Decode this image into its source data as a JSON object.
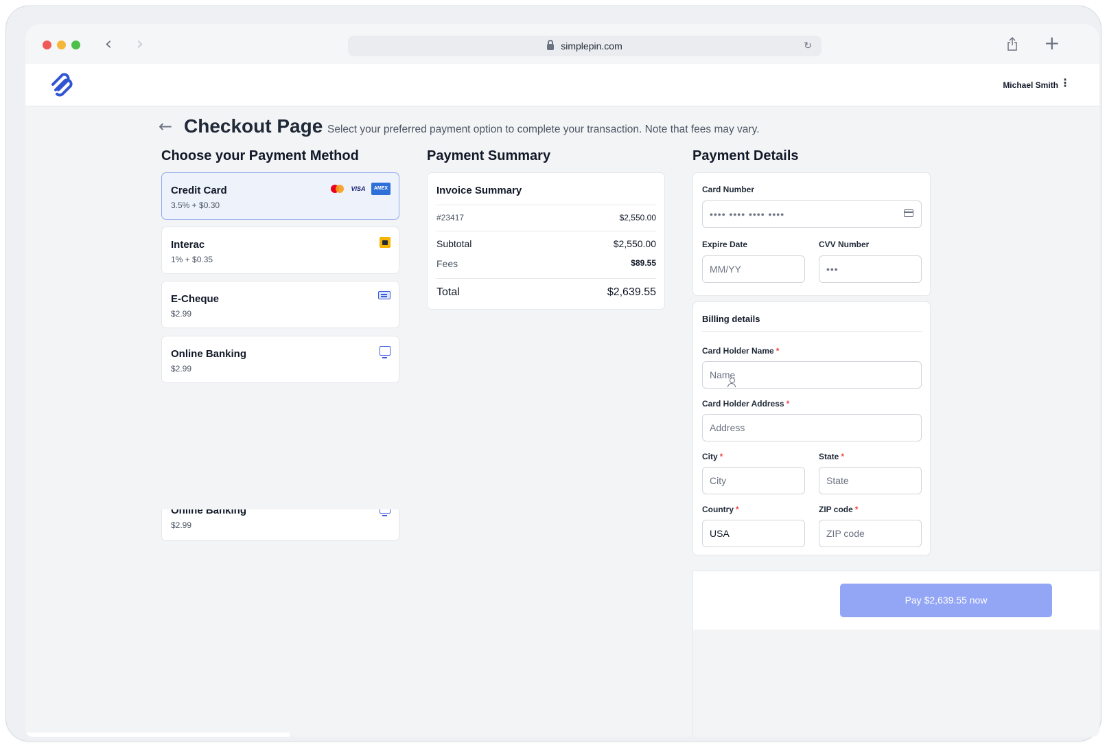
{
  "browser": {
    "url": "simplepin.com"
  },
  "header": {
    "user_name": "Michael Smith"
  },
  "page": {
    "title": "Checkout Page",
    "subtitle": "Select your preferred payment option to complete your transaction. Note that fees may vary."
  },
  "payment_methods": {
    "heading": "Choose your Payment Method",
    "items": [
      {
        "name": "Credit Card",
        "fee": "3.5% + $0.30",
        "selected": true,
        "icons": [
          "mastercard-icon",
          "visa-icon",
          "amex-icon"
        ]
      },
      {
        "name": "Interac",
        "fee": "1% + $0.35",
        "selected": false,
        "icons": [
          "interac-icon"
        ]
      },
      {
        "name": "E-Cheque",
        "fee": "$2.99",
        "selected": false,
        "icons": [
          "cheque-icon"
        ]
      },
      {
        "name": "Online Banking",
        "fee": "$2.99",
        "selected": false,
        "icons": [
          "online-banking-icon"
        ]
      }
    ],
    "ghost_item": {
      "name": "Online Banking",
      "fee": "$2.99"
    }
  },
  "summary": {
    "heading": "Payment Summary",
    "card_title": "Invoice Summary",
    "invoice_number": "#23417",
    "invoice_amount": "$2,550.00",
    "subtotal_label": "Subtotal",
    "subtotal_value": "$2,550.00",
    "fees_label": "Fees",
    "fees_value": "$89.55",
    "total_label": "Total",
    "total_value": "$2,639.55"
  },
  "details": {
    "heading": "Payment Details",
    "card_number_label": "Card Number",
    "card_number_value": "•••• •••• •••• ••••",
    "expire_label": "Expire Date",
    "expire_placeholder": "MM/YY",
    "cvv_label": "CVV Number",
    "cvv_value": "•••",
    "billing_title": "Billing details",
    "holder_name_label": "Card Holder Name",
    "holder_name_placeholder": "Name",
    "holder_address_label": "Card Holder Address",
    "holder_address_placeholder": "Address",
    "city_label": "City",
    "city_placeholder": "City",
    "state_label": "State",
    "state_placeholder": "State",
    "country_label": "Country",
    "country_value": "USA",
    "zip_label": "ZIP code",
    "zip_placeholder": "ZIP code",
    "required_mark": "*"
  },
  "pay_button": {
    "label": "Pay $2,639.55 now"
  },
  "colors": {
    "accent": "#93a5f5",
    "selected_bg": "#eef2fb",
    "required": "#ef4444"
  }
}
